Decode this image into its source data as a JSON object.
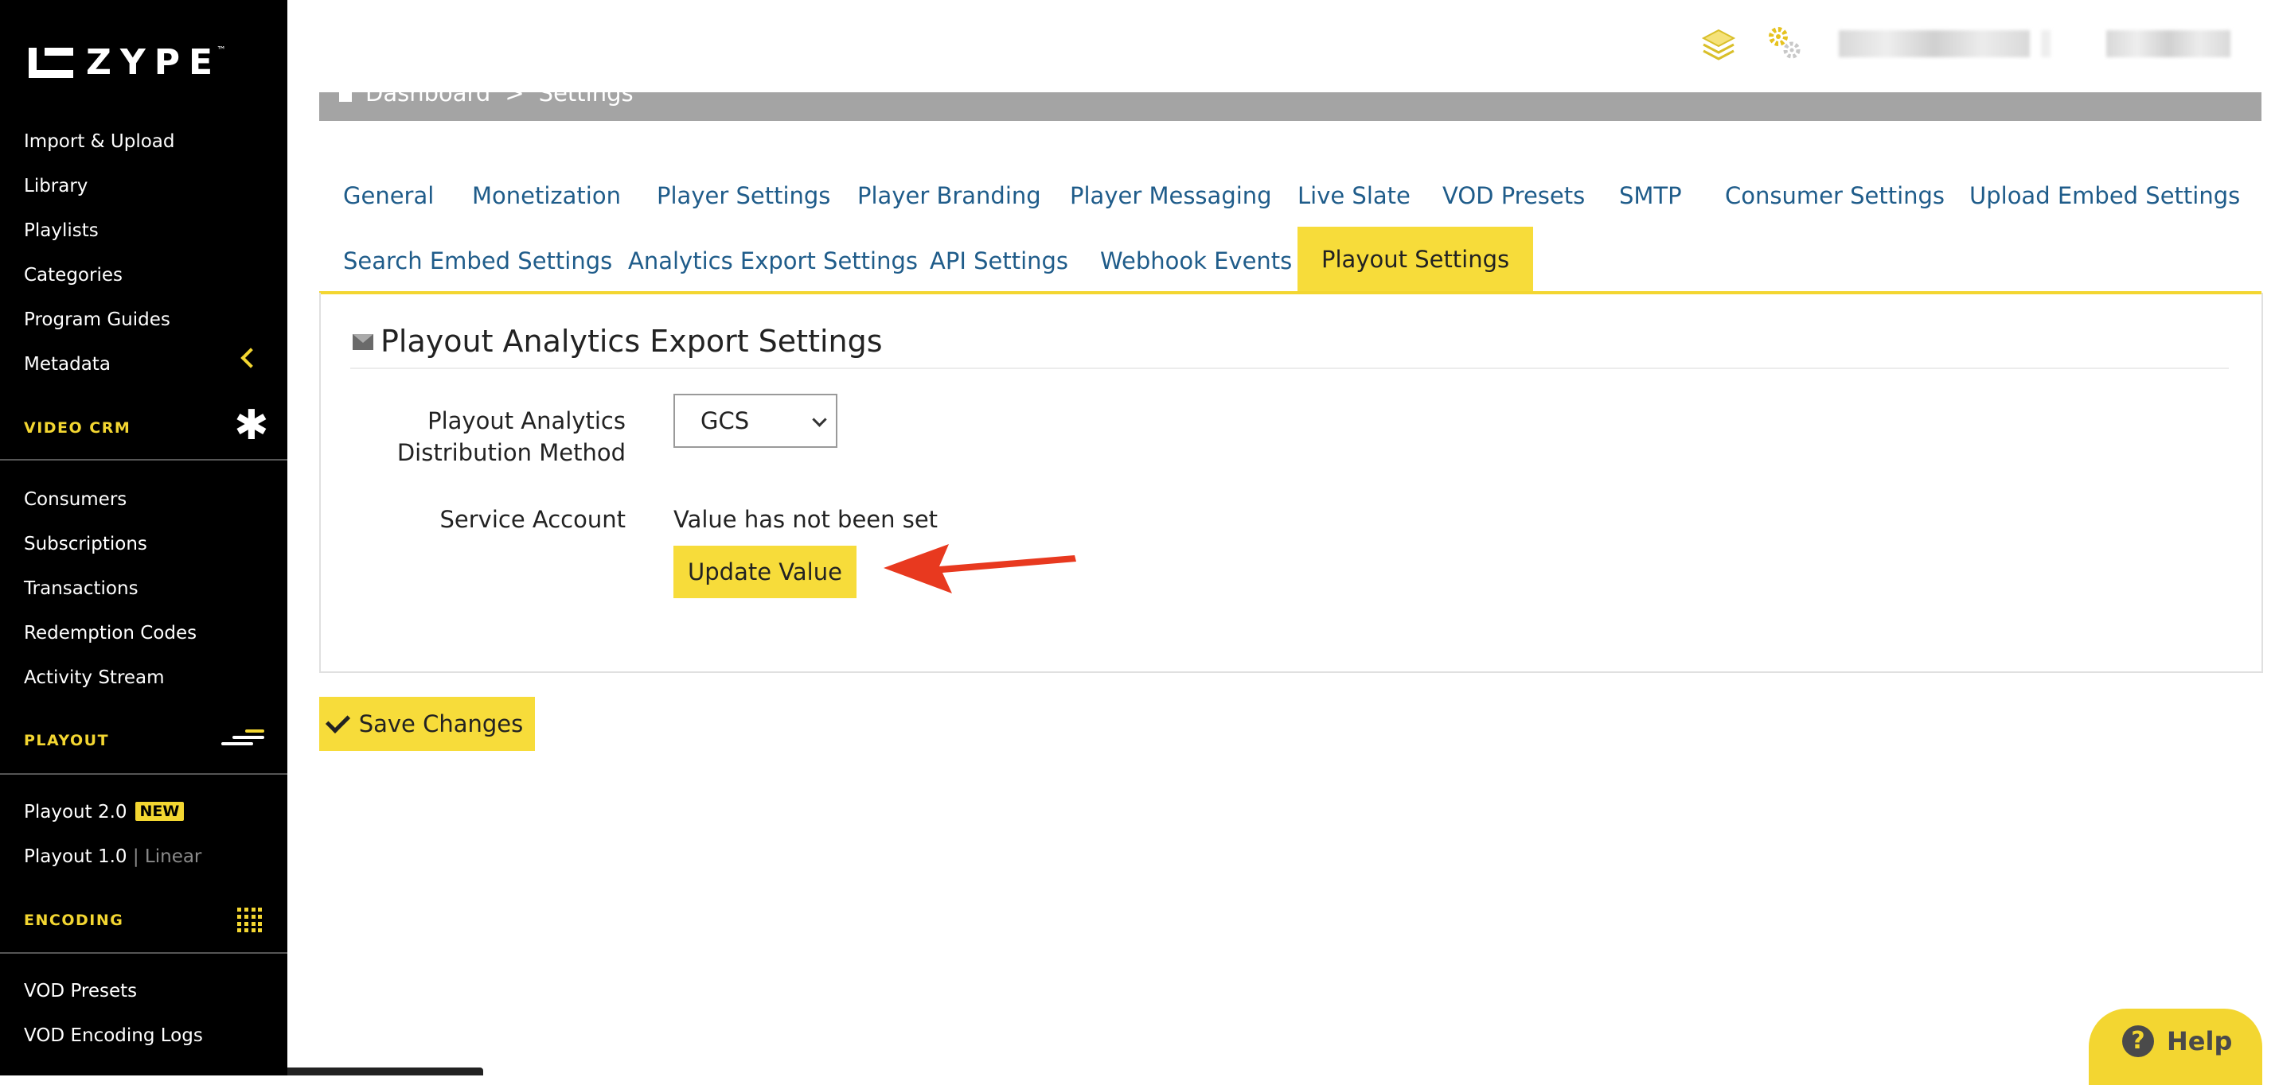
{
  "brand": {
    "name": "ZYPE",
    "tm": "™"
  },
  "sidebar": {
    "main_items": [
      {
        "label": "Import & Upload"
      },
      {
        "label": "Library"
      },
      {
        "label": "Playlists"
      },
      {
        "label": "Categories"
      },
      {
        "label": "Program Guides"
      },
      {
        "label": "Metadata"
      }
    ],
    "video_crm": {
      "heading": "VIDEO CRM",
      "items": [
        {
          "label": "Consumers"
        },
        {
          "label": "Subscriptions"
        },
        {
          "label": "Transactions"
        },
        {
          "label": "Redemption Codes"
        },
        {
          "label": "Activity Stream"
        }
      ]
    },
    "playout": {
      "heading": "PLAYOUT",
      "items": [
        {
          "label": "Playout 2.0",
          "badge": "NEW"
        },
        {
          "label": "Playout 1.0",
          "separator": "|",
          "tag": "Linear"
        }
      ]
    },
    "encoding": {
      "heading": "ENCODING",
      "items": [
        {
          "label": "VOD Presets"
        },
        {
          "label": "VOD Encoding Logs"
        }
      ]
    }
  },
  "breadcrumb": {
    "home": "Dashboard",
    "separator": ">",
    "current": "Settings"
  },
  "tabs": {
    "row1": [
      {
        "label": "General"
      },
      {
        "label": "Monetization"
      },
      {
        "label": "Player Settings"
      },
      {
        "label": "Player Branding"
      },
      {
        "label": "Player Messaging"
      },
      {
        "label": "Live Slate"
      },
      {
        "label": "VOD Presets"
      },
      {
        "label": "SMTP"
      },
      {
        "label": "Consumer Settings"
      },
      {
        "label": "Upload Embed Settings"
      }
    ],
    "row2": [
      {
        "label": "Search Embed Settings"
      },
      {
        "label": "Analytics Export Settings"
      },
      {
        "label": "API Settings"
      },
      {
        "label": "Webhook Events"
      },
      {
        "label": "Playout Settings",
        "active": true
      }
    ]
  },
  "panel": {
    "title": "Playout Analytics Export Settings",
    "distribution": {
      "label_line1": "Playout Analytics",
      "label_line2": "Distribution Method",
      "value": "GCS"
    },
    "service_account": {
      "label": "Service Account",
      "value": "Value has not been set",
      "button": "Update Value"
    }
  },
  "save_button": "Save Changes",
  "help": {
    "q": "?",
    "label": "Help"
  },
  "colors": {
    "accent": "#f7dc3a",
    "link": "#1f5c8a",
    "sidebar_bg": "#000000",
    "arrow": "#e8391f"
  },
  "icons": [
    "home-icon",
    "envelope-icon",
    "check-icon",
    "chevron-left-icon",
    "chevron-down-icon",
    "asterisk-icon",
    "playout-bars-icon",
    "grid-icon",
    "layers-icon",
    "gears-icon",
    "help-icon"
  ]
}
